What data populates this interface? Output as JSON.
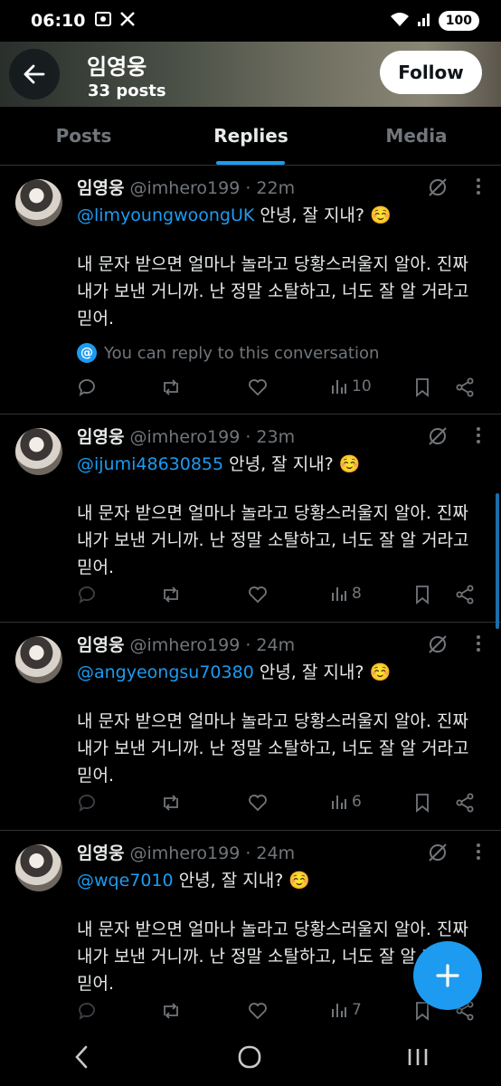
{
  "status_bar": {
    "time": "06:10",
    "battery": "100",
    "icons": [
      "screenshot-icon",
      "x-logo-icon",
      "wifi-icon",
      "signal-icon"
    ]
  },
  "header": {
    "name": "임영웅",
    "posts": "33 posts",
    "follow_label": "Follow",
    "banner_colors": [
      "#2a2f2c",
      "#8a8676"
    ]
  },
  "tabs": [
    {
      "label": "Posts",
      "active": false
    },
    {
      "label": "Replies",
      "active": true
    },
    {
      "label": "Media",
      "active": false
    }
  ],
  "tweets": [
    {
      "name": "임영웅",
      "meta": "@imhero199 · 22m",
      "mention": "@limyoungwoongUK",
      "greeting": " 안녕, 잘 지내? ☺️",
      "body_lines": [
        "내 문자 받으면 얼마나 놀라고 당황스러울지 알아. 진짜",
        "내가 보낸 거니까. 난 정말 소탈하고, 너도 잘 알 거라고",
        "믿어."
      ],
      "conversation_note": "You can reply to this conversation",
      "views": "10"
    },
    {
      "name": "임영웅",
      "meta": "@imhero199 · 23m",
      "mention": "@ijumi48630855",
      "greeting": " 안녕, 잘 지내? ☺️",
      "body_lines": [
        "내 문자 받으면 얼마나 놀라고 당황스러울지 알아. 진짜",
        "내가 보낸 거니까. 난 정말 소탈하고, 너도 잘 알 거라고",
        "믿어."
      ],
      "views": "8"
    },
    {
      "name": "임영웅",
      "meta": "@imhero199 · 24m",
      "mention": "@angyeongsu70380",
      "greeting": " 안녕, 잘 지내? ☺️",
      "body_lines": [
        "내 문자 받으면 얼마나 놀라고 당황스러울지 알아. 진짜",
        "내가 보낸 거니까. 난 정말 소탈하고, 너도 잘 알 거라고",
        "믿어."
      ],
      "views": "6"
    },
    {
      "name": "임영웅",
      "meta": "@imhero199 · 24m",
      "mention": "@wqe7010",
      "greeting": " 안녕, 잘 지내? ☺️",
      "body_lines": [
        "내 문자 받으면 얼마나 놀라고 당황스러울지 알아. 진짜",
        "내가 보낸 거니까. 난 정말 소탈하고, 너도 잘 알 거라고",
        "믿어."
      ],
      "views": "7"
    }
  ],
  "colors": {
    "accent": "#1d9bf0",
    "text": "#e7e9ea",
    "muted": "#71767b",
    "border": "#2f3336"
  }
}
